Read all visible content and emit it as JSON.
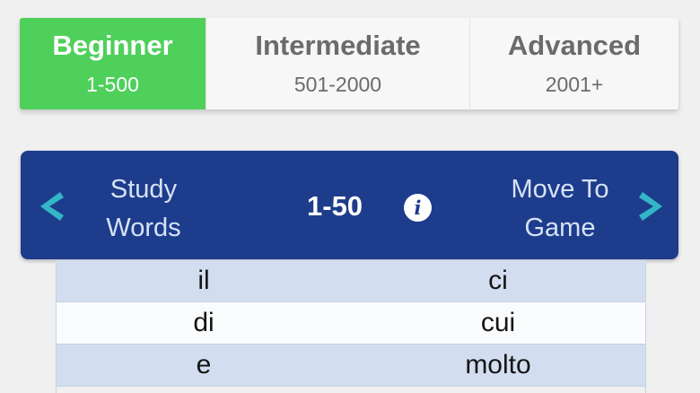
{
  "levels": [
    {
      "name": "Beginner",
      "range": "1-500",
      "active": true
    },
    {
      "name": "Intermediate",
      "range": "501-2000",
      "active": false
    },
    {
      "name": "Advanced",
      "range": "2001+",
      "active": false
    }
  ],
  "nav": {
    "study_label": "Study Words",
    "study_line1": "Study",
    "study_line2": "Words",
    "range": "1-50",
    "info_glyph": "i",
    "move_line1": "Move To",
    "move_line2": "Game",
    "left_icon": "chevron-left-icon",
    "right_icon": "chevron-right-icon"
  },
  "words": [
    [
      "il",
      "ci"
    ],
    [
      "di",
      "cui"
    ],
    [
      "e",
      "molto"
    ]
  ],
  "colors": {
    "active_tab": "#4ed05b",
    "nav_bar": "#1e3c8c",
    "chevron": "#33b6c8",
    "row_odd": "#d3ddf0",
    "row_even": "#fafbfd"
  }
}
